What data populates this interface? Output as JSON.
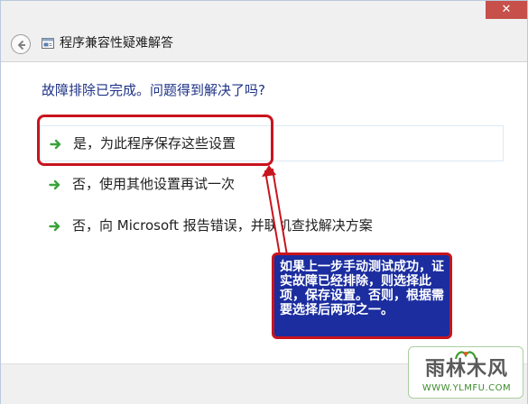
{
  "window": {
    "title": "程序兼容性疑难解答",
    "close_glyph": "✕"
  },
  "main": {
    "question": "故障排除已完成。问题得到解决了吗?",
    "options": [
      {
        "label": "是，为此程序保存这些设置"
      },
      {
        "label": "否，使用其他设置再试一次"
      },
      {
        "label": "否，向 Microsoft 报告错误，并联机查找解决方案"
      }
    ]
  },
  "annotation": {
    "callout_text": "如果上一步手动测试成功，证实故障已经排除，则选择此项，保存设置。否则，根据需要选择后两项之一。"
  },
  "watermark": {
    "name": "雨林木风",
    "url": "WWW.YLMFU.COM"
  },
  "colors": {
    "accent_text": "#1e3287",
    "arrow_green": "#3aa33a",
    "annotation_red": "#c8141e",
    "callout_blue": "#1b2d9f"
  },
  "icons": {
    "back": "back-arrow-icon",
    "app": "compatibility-app-icon",
    "option_arrow": "green-arrow-icon"
  }
}
